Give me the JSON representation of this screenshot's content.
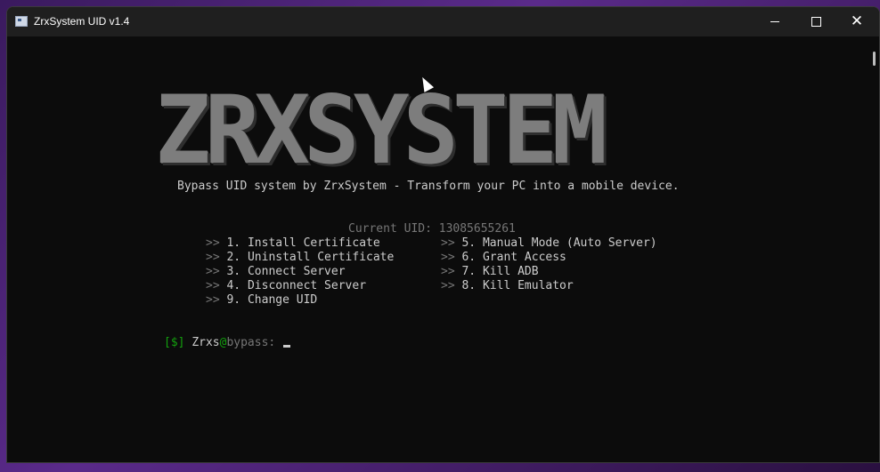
{
  "window": {
    "title": "ZrxSystem UID v1.4"
  },
  "banner": {
    "logo": "ZRXSYSTEM",
    "tagline": "Bypass UID system by ZrxSystem - Transform your PC into a mobile device."
  },
  "uid": {
    "label": "Current UID:",
    "value": "13085655261"
  },
  "menu": {
    "arrow": ">>",
    "items": [
      {
        "label": "1. Install Certificate"
      },
      {
        "label": "2. Uninstall Certificate"
      },
      {
        "label": "3. Connect Server"
      },
      {
        "label": "4. Disconnect Server"
      },
      {
        "label": "9. Change UID"
      },
      {
        "label": "5. Manual Mode (Auto Server)"
      },
      {
        "label": "6. Grant Access"
      },
      {
        "label": "7. Kill ADB"
      },
      {
        "label": "8. Kill Emulator"
      }
    ]
  },
  "prompt": {
    "open_bracket": "[",
    "dollar": "$",
    "close_bracket": "]",
    "user": "Zrxs",
    "at": "@",
    "host": "bypass",
    "colon": ":"
  },
  "colors": {
    "accent_green": "#13a10e",
    "text": "#cccccc",
    "dim": "#767676",
    "background": "#0c0c0c"
  },
  "icons": {
    "app": "terminal-app-icon",
    "minimize": "minimize-icon",
    "maximize": "maximize-icon",
    "close": "close-icon",
    "pointer": "mouse-pointer-icon"
  }
}
